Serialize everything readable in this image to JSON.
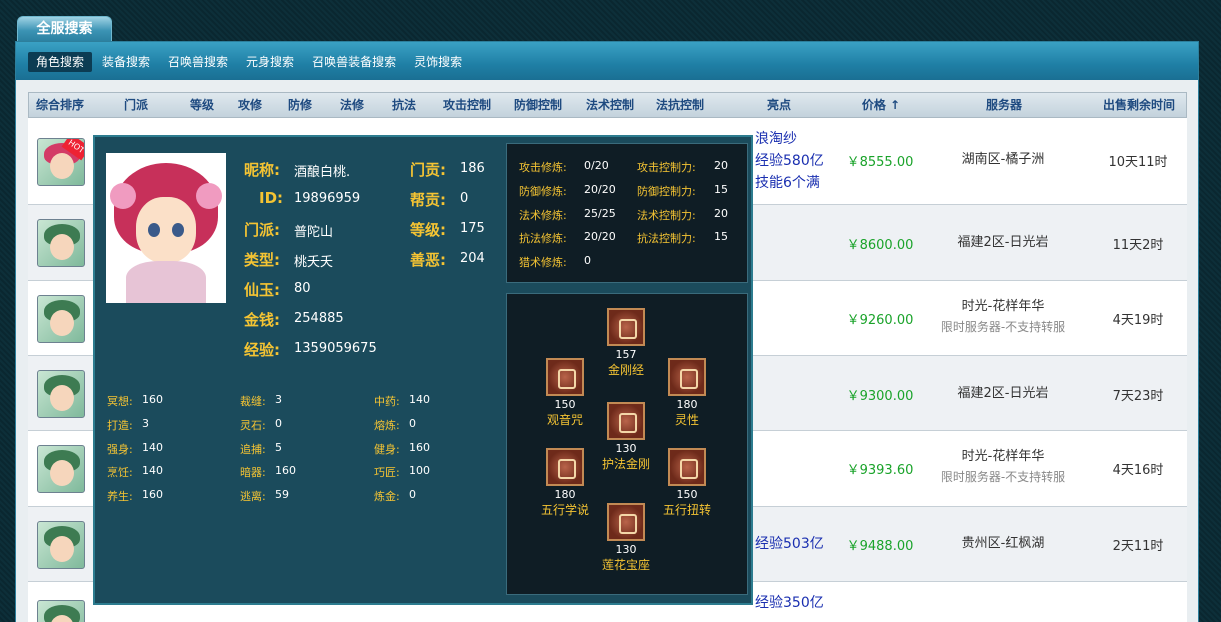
{
  "title_tab": "全服搜索",
  "sub_tabs": [
    {
      "label": "角色搜索",
      "active": true
    },
    {
      "label": "装备搜索",
      "active": false
    },
    {
      "label": "召唤兽搜索",
      "active": false
    },
    {
      "label": "元身搜索",
      "active": false
    },
    {
      "label": "召唤兽装备搜索",
      "active": false
    },
    {
      "label": "灵饰搜索",
      "active": false
    }
  ],
  "columns": [
    "综合排序",
    "门派",
    "等级",
    "攻修",
    "防修",
    "法修",
    "抗法",
    "攻击控制",
    "防御控制",
    "法术控制",
    "法抗控制",
    "亮点",
    "价格 ↑",
    "服务器",
    "出售剩余时间"
  ],
  "rows": [
    {
      "highlight_lines": [
        "浪淘纱",
        "经验580亿",
        "技能6个满"
      ],
      "price": "￥8555.00",
      "server": "湖南区-橘子洲",
      "server_note": "",
      "remain": "10天11时",
      "hot": true
    },
    {
      "highlight_lines": [],
      "price": "￥8600.00",
      "server": "福建2区-日光岩",
      "server_note": "",
      "remain": "11天2时",
      "hot": false
    },
    {
      "highlight_lines": [],
      "price": "￥9260.00",
      "server": "时光-花样年华",
      "server_note": "限时服务器-不支持转服",
      "remain": "4天19时",
      "hot": false
    },
    {
      "highlight_lines": [],
      "price": "￥9300.00",
      "server": "福建2区-日光岩",
      "server_note": "",
      "remain": "7天23时",
      "hot": false
    },
    {
      "highlight_lines": [],
      "price": "￥9393.60",
      "server": "时光-花样年华",
      "server_note": "限时服务器-不支持转服",
      "remain": "4天16时",
      "hot": false
    },
    {
      "highlight_lines": [
        "经验503亿"
      ],
      "price": "￥9488.00",
      "server": "贵州区-红枫湖",
      "server_note": "",
      "remain": "2天11时",
      "hot": false
    },
    {
      "highlight_lines": [
        "经验350亿"
      ],
      "price": "",
      "server": "",
      "server_note": "",
      "remain": "",
      "hot": false
    }
  ],
  "detail": {
    "info_left": [
      {
        "label": "昵称:",
        "value": "酒酿白桃."
      },
      {
        "label": "ID:",
        "value": "19896959"
      },
      {
        "label": "门派:",
        "value": "普陀山"
      },
      {
        "label": "类型:",
        "value": "桃夭夭"
      },
      {
        "label": "仙玉:",
        "value": "80"
      },
      {
        "label": "金钱:",
        "value": "254885"
      },
      {
        "label": "经验:",
        "value": "1359059675"
      }
    ],
    "info_right": [
      {
        "label": "门贡:",
        "value": "186"
      },
      {
        "label": "帮贡:",
        "value": "0"
      },
      {
        "label": "等级:",
        "value": "175"
      },
      {
        "label": "善恶:",
        "value": "204"
      }
    ],
    "life_skills": [
      [
        {
          "label": "冥想:",
          "value": "160"
        },
        {
          "label": "裁缝:",
          "value": "3"
        },
        {
          "label": "中药:",
          "value": "140"
        }
      ],
      [
        {
          "label": "打造:",
          "value": "3"
        },
        {
          "label": "灵石:",
          "value": "0"
        },
        {
          "label": "熔炼:",
          "value": "0"
        }
      ],
      [
        {
          "label": "强身:",
          "value": "140"
        },
        {
          "label": "追捕:",
          "value": "5"
        },
        {
          "label": "健身:",
          "value": "160"
        }
      ],
      [
        {
          "label": "烹饪:",
          "value": "140"
        },
        {
          "label": "暗器:",
          "value": "160"
        },
        {
          "label": "巧匠:",
          "value": "100"
        }
      ],
      [
        {
          "label": "养生:",
          "value": "160"
        },
        {
          "label": "逃离:",
          "value": "59"
        },
        {
          "label": "炼金:",
          "value": "0"
        }
      ]
    ],
    "cultivation_left": [
      {
        "label": "攻击修炼:",
        "value": "0/20"
      },
      {
        "label": "防御修炼:",
        "value": "20/20"
      },
      {
        "label": "法术修炼:",
        "value": "25/25"
      },
      {
        "label": "抗法修炼:",
        "value": "20/20"
      },
      {
        "label": "猎术修炼:",
        "value": "0"
      }
    ],
    "cultivation_right": [
      {
        "label": "攻击控制力:",
        "value": "20"
      },
      {
        "label": "防御控制力:",
        "value": "15"
      },
      {
        "label": "法术控制力:",
        "value": "20"
      },
      {
        "label": "抗法控制力:",
        "value": "15"
      }
    ],
    "skills": [
      {
        "name": "金刚经",
        "level": "157"
      },
      {
        "name": "观音咒",
        "level": "150"
      },
      {
        "name": "灵性",
        "level": "180"
      },
      {
        "name": "护法金刚",
        "level": "130"
      },
      {
        "name": "五行学说",
        "level": "180"
      },
      {
        "name": "五行扭转",
        "level": "150"
      },
      {
        "name": "莲花宝座",
        "level": "130"
      }
    ]
  },
  "colors": {
    "accent_blue": "#1f7fa5",
    "price_green": "#1aa32a",
    "overlay_bg": "#1b4b5c",
    "label_gold": "#f5c433"
  }
}
